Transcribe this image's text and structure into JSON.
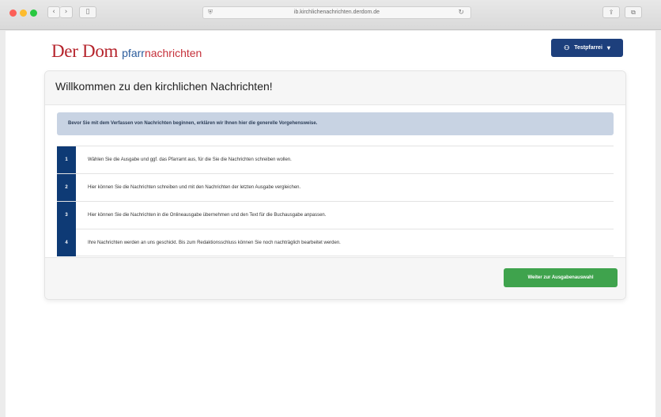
{
  "browser": {
    "url": "ib.kirchlichenachrichten.derdom.de",
    "share_icon": "share-icon",
    "tabs_icon": "tabs-icon"
  },
  "header": {
    "logo_main": "Der Dom",
    "logo_sub_a": "pfarr",
    "logo_sub_b": "nachrichten",
    "user_label": "Testpfarrei",
    "user_icon": "user-icon",
    "dropdown_icon": "caret-down-icon"
  },
  "card": {
    "title": "Willkommen zu den kirchlichen Nachrichten!",
    "info": "Bevor Sie mit dem Verfassen von Nachrichten beginnen, erklären wir Ihnen hier die generelle Vorgehensweise.",
    "steps": [
      {
        "num": "1",
        "text": "Wählen Sie die Ausgabe und ggf. das Pfarramt aus, für die Sie die Nachrichten schreiben wollen."
      },
      {
        "num": "2",
        "text": "Hier können Sie die Nachrichten schreiben und mit den Nachrichten der letzten Ausgabe vergleichen."
      },
      {
        "num": "3",
        "text": "Hier können Sie die Nachrichten in die Onlineausgabe übernehmen und den Text für die Buchausgabe anpassen."
      },
      {
        "num": "4",
        "text": "Ihre Nachrichten werden an uns geschickt. Bis zum Redaktionsschluss können Sie noch nachträglich bearbeitet werden."
      }
    ],
    "next_button": "Weiter zur Ausgabenauswahl"
  },
  "colors": {
    "brand_red": "#b5232b",
    "brand_blue": "#1d3f7c",
    "step_blue": "#0e3a75",
    "success_green": "#3fa34d",
    "info_bg": "#c8d3e3"
  }
}
